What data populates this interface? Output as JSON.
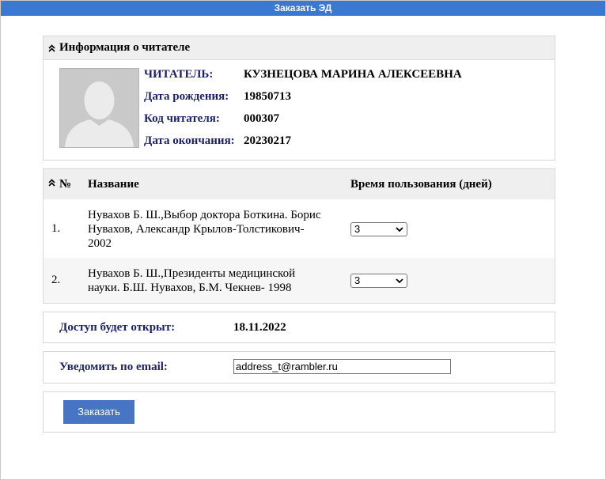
{
  "window": {
    "title": "Заказать ЭД"
  },
  "reader_panel": {
    "title": "Информация о читателе",
    "fields": [
      {
        "label": "ЧИТАТЕЛЬ:",
        "value": "КУЗНЕЦОВА МАРИНА АЛЕКСЕЕВНА",
        "label_color": "#1d1f66"
      },
      {
        "label": "Дата рождения:",
        "value": "19850713",
        "label_color": "#1d1f66"
      },
      {
        "label": "Код читателя:",
        "value": "000307",
        "label_color": "#1d1f66"
      },
      {
        "label": "Дата окончания:",
        "value": "20230217",
        "label_color": "#1d1f66"
      }
    ],
    "avatar_icon": "person-silhouette-icon"
  },
  "books_table": {
    "columns": {
      "num": "№",
      "title": "Название",
      "time": "Время пользования (дней)"
    },
    "rows": [
      {
        "index": "1.",
        "title": "Нувахов Б. Ш.,Выбор доктора Боткина. Борис Нувахов, Александр Крылов-Толстикович- 2002",
        "days": "3"
      },
      {
        "index": "2.",
        "title": "Нувахов Б. Ш.,Президенты медицинской науки. Б.Ш. Нувахов, Б.М. Чекнев- 1998",
        "days": "3"
      }
    ]
  },
  "access": {
    "label": "Доступ будет открыт:",
    "value": "18.11.2022"
  },
  "notify": {
    "label": "Уведомить по email:",
    "email": "address_t@rambler.ru"
  },
  "order": {
    "button_label": "Заказать"
  },
  "colors": {
    "titlebar": "#3a79d1",
    "button": "#4775c4",
    "label": "#1d1f66"
  }
}
